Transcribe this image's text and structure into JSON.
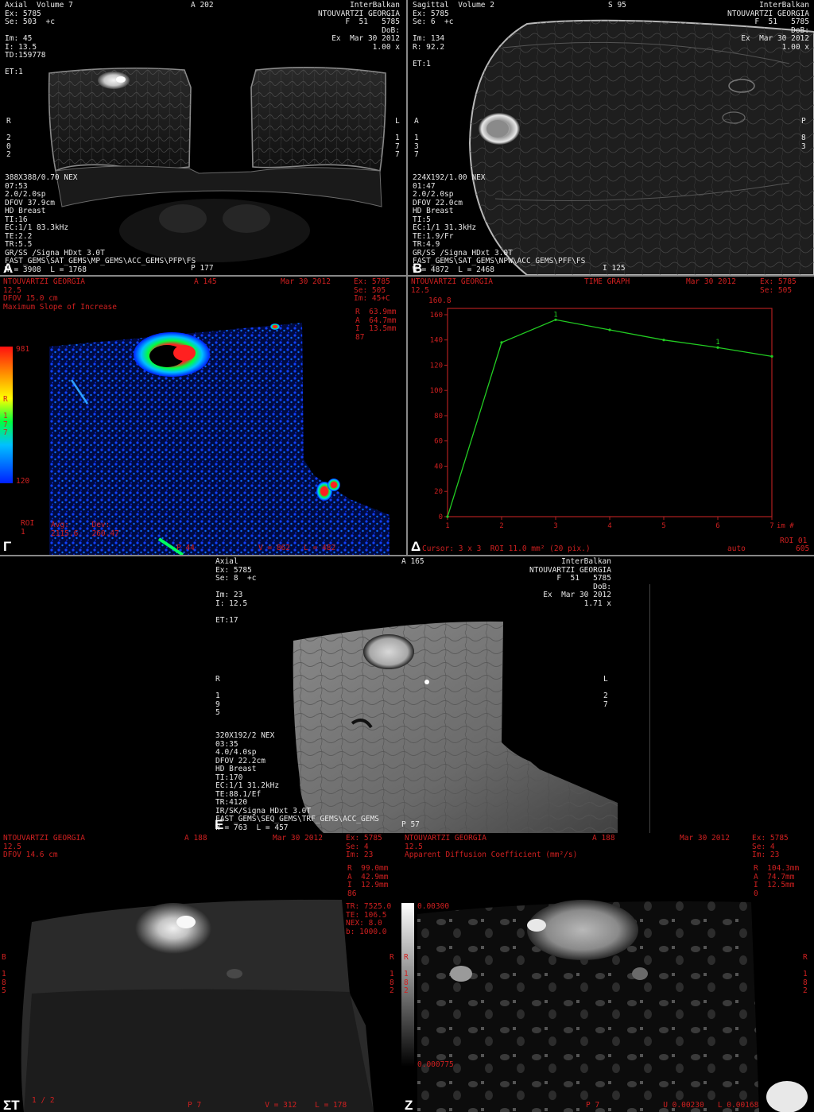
{
  "panels": {
    "A": {
      "letter": "A",
      "tl": "Axial  Volume 7\nEx: 5785\nSe: 503  +c\n\nIm: 45\nI: 13.5\nTD:159778\n\nET:1",
      "tc": "A 202",
      "tr": "InterBalkan\nNTOUVARTZI GEORGIA\nF  51   5785\nDoB:\nEx  Mar 30 2012\n1.00 x",
      "lmid": "R\n\n2\n0\n2",
      "rmid": "L\n\n1\n7\n7",
      "bl": "388X388/0.70 NEX\n07:53\n2.0/2.0sp\nDFOV 37.9cm\nHD Breast\nTI:16\nEC:1/1 83.3kHz\nTE:2.2\nTR:5.5\nGR/SS /Signa HDxt 3.0T\nFAST_GEMS\\SAT_GEMS\\MP_GEMS\\ACC_GEMS\\PFP\\FS\nW = 3908  L = 1768",
      "bc": "P 177"
    },
    "B": {
      "letter": "B",
      "tl": "Sagittal  Volume 2\nEx: 5785\nSe: 6  +c\n\nIm: 134\nR: 92.2\n\nET:1",
      "tc": "S 95",
      "tr": "InterBalkan\nNTOUVARTZI GEORGIA\nF  51   5785\nDoB:\nEx  Mar 30 2012\n1.00 x",
      "lmid": "A\n\n1\n3\n7",
      "rmid": "P\n\n8\n3",
      "bl": "224X192/1.00 NEX\n01:47\n2.0/2.0sp\nDFOV 22.0cm\nHD Breast\nTI:5\nEC:1/1 31.3kHz\nTE:1.9/Fr\nTR:4.9\nGR/SS /Signa HDxt 3.0T\nFAST_GEMS\\SAT_GEMS\\NPW\\ACC_GEMS\\PFF\\FS\nW = 4872  L = 2468",
      "bc": "I 125"
    },
    "G": {
      "letter": "Γ",
      "tl": "NTOUVARTZI GEORGIA\n12.5\nDFOV 15.0 cm\nMaximum Slope of Increase",
      "tc": "A 145",
      "date": "Mar 30 2012",
      "tr": "Ex: 5785\nSe: 505\nIm: 45+C",
      "coords": "R  63.9mm\nA  64.7mm\nI  13.5mm\n87",
      "scale_top": "981",
      "scale_mid": "R\n\n1\n7\n7",
      "scale_bot": "120",
      "roi": "ROI\n1",
      "avg": "Avg:     Dev:\n2115.6   260.47",
      "bottom": "P 44              V = 862   L = 482"
    },
    "D": {
      "letter": "Δ",
      "tl": "NTOUVARTZI GEORGIA\n12.5",
      "tc": "TIME GRAPH",
      "date": "Mar 30 2012",
      "tr": "Ex: 5785\nSe: 505",
      "bottom": "Cursor: 3 x 3  ROI 11.0 mm² (20 pix.)",
      "roi_label": "ROI 01",
      "auto": "auto",
      "num": "605",
      "ylabel": "160.8",
      "chart_data": {
        "type": "line",
        "x": [
          1,
          2,
          3,
          4,
          5,
          6,
          7
        ],
        "y": [
          0,
          138,
          156,
          148,
          140,
          134,
          127
        ],
        "xlim": [
          1,
          7
        ],
        "ylim": [
          0,
          165
        ],
        "yticks": [
          0,
          20,
          40,
          60,
          80,
          100,
          120,
          140,
          160
        ],
        "xticks": [
          1,
          2,
          3,
          4,
          5,
          6,
          7
        ],
        "xunit": "im #",
        "color": "#22cc22",
        "point_labels": [
          {
            "x": 3,
            "label": "1"
          },
          {
            "x": 6,
            "label": "1"
          }
        ]
      }
    },
    "E": {
      "letter": "E",
      "tl": "Axial\nEx: 5785\nSe: 8  +c\n\nIm: 23\nI: 12.5\n\nET:17",
      "tc": "A 165",
      "tr": "InterBalkan\nNTOUVARTZI GEORGIA\nF  51   5785\nDoB:\nEx  Mar 30 2012\n1.71 x",
      "lmid": "R\n\n1\n9\n5",
      "rmid": "L\n\n2\n7",
      "bl": "320X192/2 NEX\n03:35\n4.0/4.0sp\nDFOV 22.2cm\nHD Breast\nTI:170\nEC:1/1 31.2kHz\nTE:88.1/Ef\nTR:4120\nIR/SK/Signa HDxt 3.0T\nFAST_GEMS\\SEQ_GEMS\\TRF_GEMS\\ACC_GEMS\nW = 763  L = 457",
      "bc": "P 57"
    },
    "ST": {
      "letter": "ΣΤ",
      "tl": "NTOUVARTZI GEORGIA\n12.5\nDFOV 14.6 cm",
      "tc": "A 188",
      "date": "Mar 30 2012",
      "tr": "Ex: 5785\nSe: 4\nIm: 23",
      "coords": "R  99.0mm\nA  42.9mm\nI  12.9mm\n86",
      "params": "TR: 7525.0\nTE: 106.5\nNEX: 8.0\nb: 1000.0",
      "rmid": "R\n\n1\n8\n2",
      "lmid": "B\n\n1\n8\n5",
      "page": "1 / 2",
      "bottom": "P 7              V = 312    L = 178"
    },
    "Z": {
      "letter": "Z",
      "tl": "NTOUVARTZI GEORGIA\n12.5\nApparent Diffusion Coefficient (mm²/s)",
      "tc": "A 188",
      "date": "Mar 30 2012",
      "tr": "Ex: 5785\nSe: 4\nIm: 23",
      "coords": "R  104.3mm\nA  74.7mm\nI  12.5mm\n0",
      "scale_top": "0.00300",
      "scale_mid": "R\n\n1\n8\n2",
      "scale_bot": "0.000775",
      "rmid": "R\n\n1\n8\n2",
      "bottom": "P 7              U 0.00230   L 0.00168"
    }
  }
}
